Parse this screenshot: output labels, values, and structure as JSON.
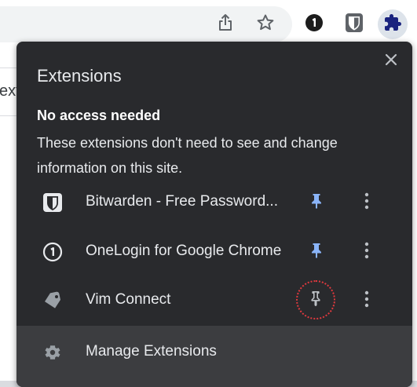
{
  "page": {
    "partial_text": "ext"
  },
  "toolbar": {
    "icons": [
      "share-icon",
      "star-icon",
      "onelogin-icon",
      "bitwarden-icon",
      "puzzle-icon"
    ]
  },
  "popup": {
    "title": "Extensions",
    "close_icon": "close-icon",
    "section_heading": "No access needed",
    "section_description": "These extensions don't need to see and change information on this site.",
    "extensions": [
      {
        "name": "Bitwarden - Free Password...",
        "icon": "bitwarden-icon",
        "pinned": true
      },
      {
        "name": "OneLogin for Google Chrome",
        "icon": "onelogin-icon",
        "pinned": true
      },
      {
        "name": "Vim Connect",
        "icon": "tag-icon",
        "pinned": false
      }
    ],
    "footer": {
      "label": "Manage Extensions",
      "icon": "gear-icon"
    }
  },
  "colors": {
    "popup_bg": "#292a2d",
    "footer_bg": "#3c3d40",
    "pinned": "#8ab4f8",
    "unpinned": "#9aa0a6",
    "highlight": "#e0393e"
  }
}
